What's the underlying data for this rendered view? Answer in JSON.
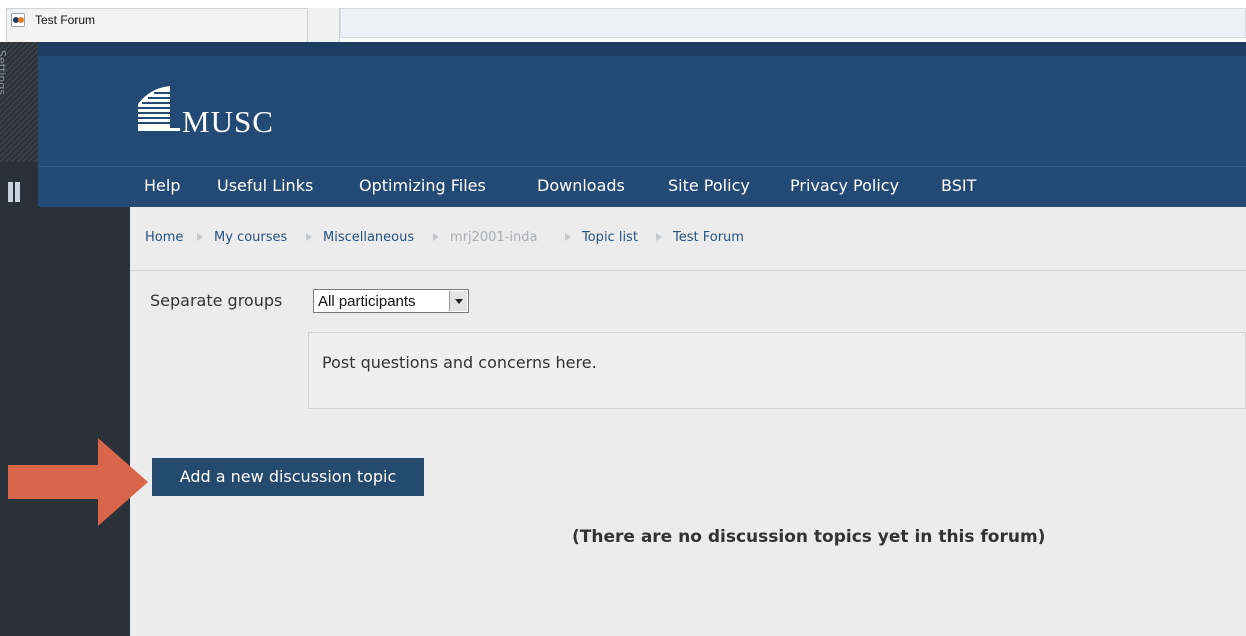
{
  "browser": {
    "tab_title": "Test Forum"
  },
  "side_rail": {
    "label": "Settings"
  },
  "site": {
    "logo_text": "MUSC"
  },
  "nav": {
    "items": [
      "Help",
      "Useful Links",
      "Optimizing Files",
      "Downloads",
      "Site Policy",
      "Privacy Policy",
      "BSIT"
    ]
  },
  "breadcrumb": {
    "items": [
      {
        "label": "Home",
        "link": true
      },
      {
        "label": "My courses",
        "link": true
      },
      {
        "label": "Miscellaneous",
        "link": true
      },
      {
        "label": "mrj2001-inda",
        "link": false
      },
      {
        "label": "Topic list",
        "link": true
      },
      {
        "label": "Test Forum",
        "link": true
      }
    ]
  },
  "groups": {
    "label": "Separate groups",
    "selected": "All participants"
  },
  "forum": {
    "intro": "Post questions and concerns here.",
    "add_button": "Add a new discussion topic",
    "empty_message": "(There are no discussion topics yet in this forum)"
  },
  "colors": {
    "header": "#234a75",
    "button": "#244a6e",
    "arrow": "#d9664a",
    "link": "#25527f"
  }
}
